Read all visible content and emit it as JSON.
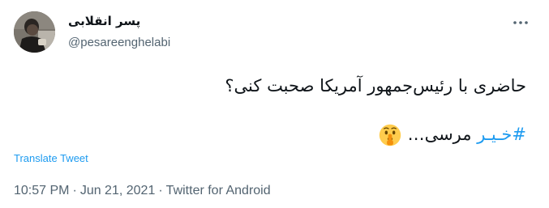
{
  "author": {
    "display_name": "پسر انقلابی",
    "handle": "@pesareenghelabi"
  },
  "tweet": {
    "line1": "حاضری با رئیس‌جمهور آمریکا صحبت کنی؟",
    "hashtag": "#خـیـر",
    "line2_rest": " مرسی…",
    "emoji": "shushing-face-icon"
  },
  "translate_label": "Translate Tweet",
  "meta": {
    "time": "10:57 PM",
    "separator": "·",
    "date": "Jun 21, 2021",
    "source": "Twitter for Android"
  },
  "colors": {
    "link": "#1d9bf0",
    "secondary": "#536471",
    "text": "#0f1419"
  }
}
